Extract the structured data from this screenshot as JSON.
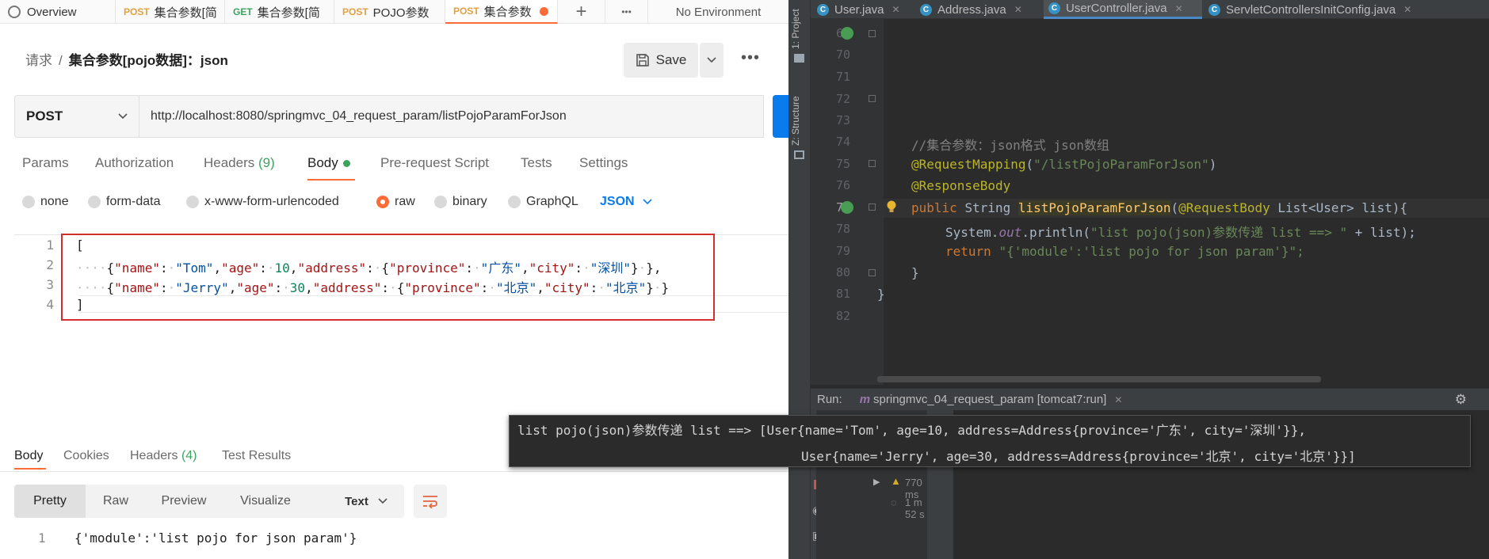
{
  "postman": {
    "tabs": [
      {
        "label": "Overview"
      },
      {
        "method": "POST",
        "label": "集合参数[简"
      },
      {
        "method": "GET",
        "label": "集合参数[简"
      },
      {
        "method": "POST",
        "label": "POJO参数"
      },
      {
        "method": "POST",
        "label": "集合参数"
      }
    ],
    "add_tab": "+",
    "more_tabs": "•••",
    "environment": "No Environment",
    "breadcrumb": {
      "parent": "请求",
      "separator": "/",
      "current": "集合参数[pojo数据]：json"
    },
    "save_label": "Save",
    "more": "•••",
    "method": "POST",
    "url": "http://localhost:8080/springmvc_04_request_param/listPojoParamForJson",
    "request_tabs": {
      "params": "Params",
      "authorization": "Authorization",
      "headers": "Headers",
      "headers_count": "(9)",
      "body": "Body",
      "pre_request": "Pre-request Script",
      "tests": "Tests",
      "settings": "Settings"
    },
    "body_types": {
      "none": "none",
      "form_data": "form-data",
      "urlencoded": "x-www-form-urlencoded",
      "raw": "raw",
      "binary": "binary",
      "graphql": "GraphQL",
      "json": "JSON"
    },
    "editor": {
      "line_numbers": [
        "1",
        "2",
        "3",
        "4"
      ],
      "line1": "[",
      "line4": "]",
      "rows": [
        {
          "name": "Tom",
          "age": "10",
          "province": "广东",
          "city": "深圳"
        },
        {
          "name": "Jerry",
          "age": "30",
          "province": "北京",
          "city": "北京"
        }
      ],
      "keys": {
        "name": "\"name\"",
        "age": "\"age\"",
        "address": "\"address\"",
        "province": "\"province\"",
        "city": "\"city\""
      }
    },
    "response_tabs": {
      "body": "Body",
      "cookies": "Cookies",
      "headers": "Headers",
      "headers_count": "(4)",
      "test_results": "Test Results"
    },
    "response_view": {
      "pretty": "Pretty",
      "raw": "Raw",
      "preview": "Preview",
      "visualize": "Visualize",
      "format": "Text"
    },
    "response_line_number": "1",
    "response_body": "{'module':'list pojo for json param'}"
  },
  "intellij": {
    "side_labels": {
      "project": "1: Project",
      "structure": "Z: Structure"
    },
    "file_tabs": [
      {
        "label": "User.java"
      },
      {
        "label": "Address.java"
      },
      {
        "label": "UserController.java"
      },
      {
        "label": "ServletControllersInitConfig.java"
      }
    ],
    "line_numbers": [
      "69",
      "70",
      "71",
      "72",
      "73",
      "74",
      "75",
      "76",
      "77",
      "78",
      "79",
      "80",
      "81",
      "82"
    ],
    "code": {
      "comment": "//集合参数：json格式 json数组",
      "mapping_annotation": "@RequestMapping",
      "mapping_value": "\"/listPojoParamForJson\"",
      "response_body": "@ResponseBody",
      "kw_public": "public",
      "type_string": "String",
      "method_name": "listPojoParamForJson",
      "request_body": "@RequestBody",
      "params": "List<User> list){",
      "sysout_prefix": "System.",
      "sysout_out": "out",
      "sysout_println": ".println(",
      "sysout_string": "\"list pojo(json)参数传递 list ==> \"",
      "sysout_tail": " + list);",
      "kw_return": "return",
      "return_value": "\"{'module':'list pojo for json param'}\";",
      "close1": "}",
      "close2": "}"
    },
    "run": {
      "label": "Run:",
      "config": "springmvc_04_request_param [tomcat7:run]",
      "time1": "770 ms",
      "time2": "1 m 52 s"
    },
    "console": {
      "line1": "list pojo(json)参数传递 list ==> [User{name='Tom', age=10, address=Address{province='广东', city='深圳'}},",
      "line2": "User{name='Jerry', age=30, address=Address{province='北京', city='北京'}}]"
    }
  }
}
